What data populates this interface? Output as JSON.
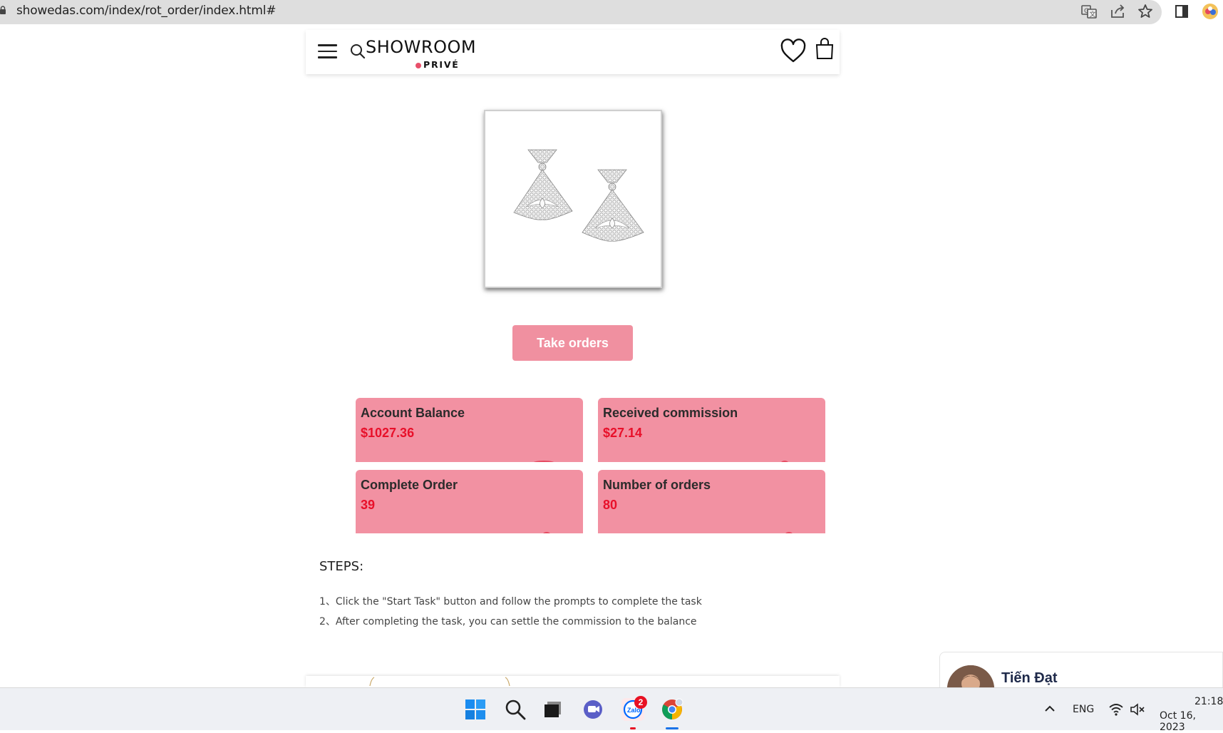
{
  "browser": {
    "url": "showedas.com/index/rot_order/index.html#"
  },
  "header": {
    "logo_main": "SHOWROOM",
    "logo_sub": "PRIVÉ"
  },
  "actions": {
    "take_orders_label": "Take orders"
  },
  "stats": [
    {
      "label": "Account Balance",
      "value": "$1027.36"
    },
    {
      "label": "Received commission",
      "value": "$27.14"
    },
    {
      "label": "Complete Order",
      "value": "39"
    },
    {
      "label": "Number of orders",
      "value": "80"
    }
  ],
  "steps": {
    "title": "STEPS:",
    "items": [
      "1、Click the \"Start Task\" button and follow the prompts to complete the task",
      "2、After completing the task, you can settle the commission to the balance"
    ]
  },
  "chat": {
    "name": "Tiến Đạt"
  },
  "taskbar": {
    "zalo_badge": "2",
    "zalo_label": "Zalo",
    "language": "ENG",
    "time": "21:18",
    "date": "Oct 16, 2023"
  },
  "colors": {
    "accent_pink": "#f291a2",
    "value_red": "#e8102a",
    "logo_dot": "#e8506a"
  }
}
